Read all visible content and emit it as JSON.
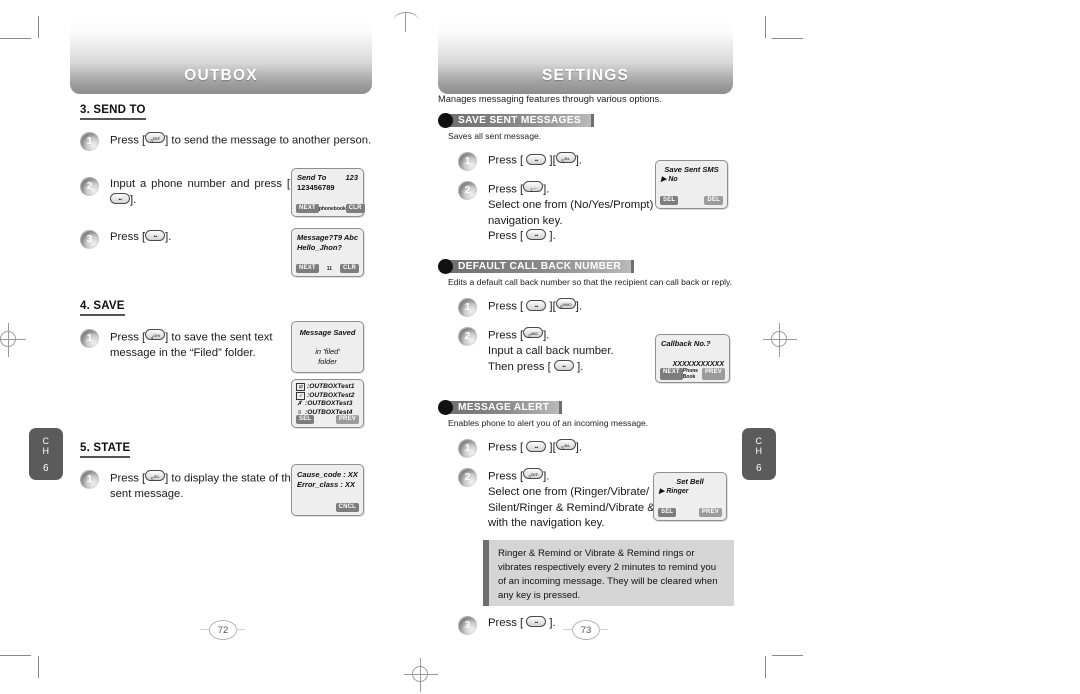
{
  "crop_marks": {
    "registration_icon": "registration-crosshair"
  },
  "left_page": {
    "chapter_tab": {
      "label_line1": "C",
      "label_line2": "H",
      "number": "6"
    },
    "banner_title": "OUTBOX",
    "page_number": "72",
    "sections": [
      {
        "heading": "3. SEND TO",
        "steps": [
          {
            "num": "1",
            "parts": [
              "Press [",
              "KEY:3 DEF",
              "] to send the message to another person."
            ]
          },
          {
            "num": "2",
            "parts": [
              "Input a phone number and press [",
              "KEY:OK",
              "]."
            ]
          },
          {
            "num": "3",
            "parts": [
              "Press [",
              "KEY:OK",
              "]."
            ]
          }
        ]
      },
      {
        "heading": "4. SAVE",
        "steps": [
          {
            "num": "1",
            "parts": [
              "Press [",
              "KEY:4 GHI",
              "] to save the sent text message in the “Filed” folder."
            ]
          }
        ]
      },
      {
        "heading": "5. STATE",
        "steps": [
          {
            "num": "1",
            "parts": [
              "Press [",
              "KEY:5 JKL",
              "] to display the state of the sent message."
            ]
          }
        ]
      }
    ],
    "screens": [
      {
        "name": "send-to-screen",
        "title_left": "Send To",
        "title_right": "123",
        "line2": "123456789",
        "soft_left": "NEXT",
        "soft_mid": "phonebook",
        "soft_right": "CLR"
      },
      {
        "name": "message-entry-screen",
        "title_left": "Message?",
        "title_right": "T9 Abc",
        "line2": "Hello_Jhon?",
        "soft_left": "NEXT",
        "soft_mid": "11",
        "soft_right": "CLR"
      },
      {
        "name": "message-saved-screen",
        "title_left": "Message Saved",
        "line2": "in 'filed'",
        "line3": "folder"
      },
      {
        "name": "outbox-list-screen",
        "items": [
          ":OUTBOXTest1",
          ":OUTBOXTest2",
          ":OUTBOXTest3",
          ":OUTBOXTest4"
        ],
        "soft_left": "SEL",
        "soft_right": "PREV"
      },
      {
        "name": "error-state-screen",
        "line1": "Cause_code : XX",
        "line2": "Error_class : XX",
        "soft_right": "CNCL"
      }
    ]
  },
  "right_page": {
    "chapter_tab": {
      "label_line1": "C",
      "label_line2": "H",
      "number": "6"
    },
    "banner_title": "SETTINGS",
    "page_number": "73",
    "intro": "Manages messaging features through various options.",
    "sections": [
      {
        "title": "SAVE SENT MESSAGES",
        "description": "Saves all sent message.",
        "steps": [
          {
            "num": "1",
            "parts": [
              "Press [ ",
              "KEY:OK",
              " ][",
              "KEY:5 JKL",
              "]."
            ]
          },
          {
            "num": "2",
            "parts": [
              "Press [",
              "KEY:1",
              "].\nSelect one from (No/Yes/Prompt) with the navigation key.\nPress [ ",
              "KEY:OK",
              " ]."
            ]
          }
        ]
      },
      {
        "title": "DEFAULT CALL BACK NUMBER",
        "description": "Edits a default call back number so that the recipient can call back or reply.",
        "steps": [
          {
            "num": "1",
            "parts": [
              "Press [ ",
              "KEY:OK",
              " ][",
              "KEY:6 MNO",
              "]."
            ]
          },
          {
            "num": "2",
            "parts": [
              "Press [",
              "KEY:2 ABC",
              "].\nInput a call back number.\nThen press [ ",
              "KEY:OK",
              " ]."
            ]
          }
        ]
      },
      {
        "title": "MESSAGE ALERT",
        "description": "Enables phone to alert you of an incoming message.",
        "steps": [
          {
            "num": "1",
            "parts": [
              "Press [ ",
              "KEY:OK",
              " ][",
              "KEY:5 JKL",
              "]."
            ]
          },
          {
            "num": "2",
            "parts": [
              "Press [",
              "KEY:3 DEF",
              "].\nSelect one from (Ringer/Vibrate/ Silent/Ringer & Remind/Vibrate & Remind) with the navigation key."
            ]
          },
          {
            "num": "3",
            "parts": [
              "Press [ ",
              "KEY:OK",
              " ]."
            ]
          }
        ]
      }
    ],
    "note": "Ringer & Remind or Vibrate & Remind rings or vibrates respectively every 2 minutes to remind you of an incoming message. They will be cleared when any key is pressed.",
    "screens": [
      {
        "name": "save-sent-sms-screen",
        "title": "Save Sent SMS",
        "selected": "▶ No",
        "soft_left": "SEL",
        "soft_right": "DEL"
      },
      {
        "name": "callback-number-screen",
        "title": "Callback No.?",
        "value": "XXXXXXXXXXX",
        "soft_left": "NEXT",
        "soft_mid": "Phone Book",
        "soft_right": "PREV"
      },
      {
        "name": "set-bell-screen",
        "title": "Set Bell",
        "selected": "▶ Ringer",
        "soft_left": "SEL",
        "soft_right": "PREV"
      }
    ]
  },
  "keys": {
    "k1": {
      "big": "1",
      "sub": "⊕"
    },
    "k2": {
      "big": "2",
      "sub": "ABC"
    },
    "k3": {
      "big": "3",
      "sub": "DEF"
    },
    "k4": {
      "big": "4",
      "sub": "GHI"
    },
    "k5": {
      "big": "5",
      "sub": "JKL"
    },
    "k6": {
      "big": "6",
      "sub": "MNO"
    },
    "ok": {
      "big": "··",
      "sub": ""
    }
  },
  "colors": {
    "tab_gray": "#5b5b5b",
    "header_gray": "#8c8c8c",
    "lcd_bg": "#eeeeee",
    "note_bg": "#d5d5d5",
    "soft_key": "#7d7d7d"
  }
}
